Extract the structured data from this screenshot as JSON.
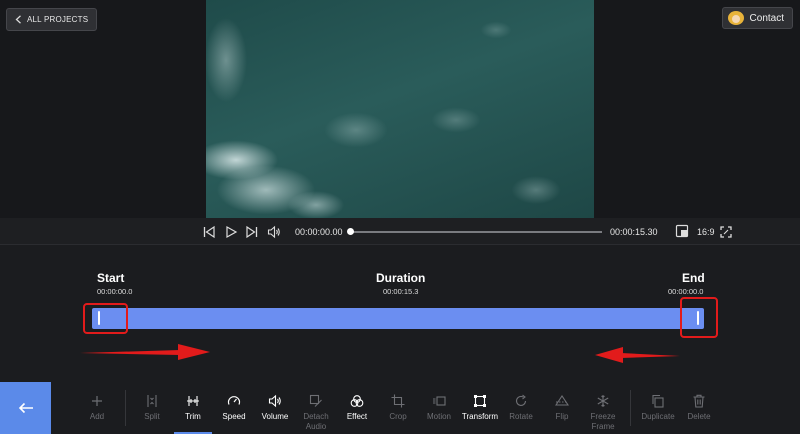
{
  "header": {
    "back_projects_label": "ALL PROJECTS",
    "contact_label": "Contact"
  },
  "player": {
    "current_time": "00:00:00.00",
    "total_time": "00:00:15.30",
    "aspect_ratio": "16:9",
    "progress": 0
  },
  "trim": {
    "start_label": "Start",
    "start_time": "00:00:00.0",
    "duration_label": "Duration",
    "duration_time": "00:00:15.3",
    "end_label": "End",
    "end_time": "00:00:00.0"
  },
  "toolbar": {
    "tools": [
      {
        "label": "Add",
        "icon": "plus-icon"
      },
      {
        "label": "Split",
        "icon": "split-icon"
      },
      {
        "label": "Trim",
        "icon": "trim-icon"
      },
      {
        "label": "Speed",
        "icon": "speed-icon"
      },
      {
        "label": "Volume",
        "icon": "volume-icon"
      },
      {
        "label": "Detach Audio",
        "icon": "detach-audio-icon"
      },
      {
        "label": "Effect",
        "icon": "effect-icon"
      },
      {
        "label": "Crop",
        "icon": "crop-icon"
      },
      {
        "label": "Motion",
        "icon": "motion-icon"
      },
      {
        "label": "Transform",
        "icon": "transform-icon"
      },
      {
        "label": "Rotate",
        "icon": "rotate-icon"
      },
      {
        "label": "Flip",
        "icon": "flip-icon"
      },
      {
        "label": "Freeze Frame",
        "icon": "freeze-frame-icon"
      },
      {
        "label": "Duplicate",
        "icon": "duplicate-icon"
      },
      {
        "label": "Delete",
        "icon": "delete-icon"
      }
    ]
  },
  "colors": {
    "accent": "#5b8ae9",
    "track": "#6b8ef1",
    "highlight": "#e21b1b"
  }
}
